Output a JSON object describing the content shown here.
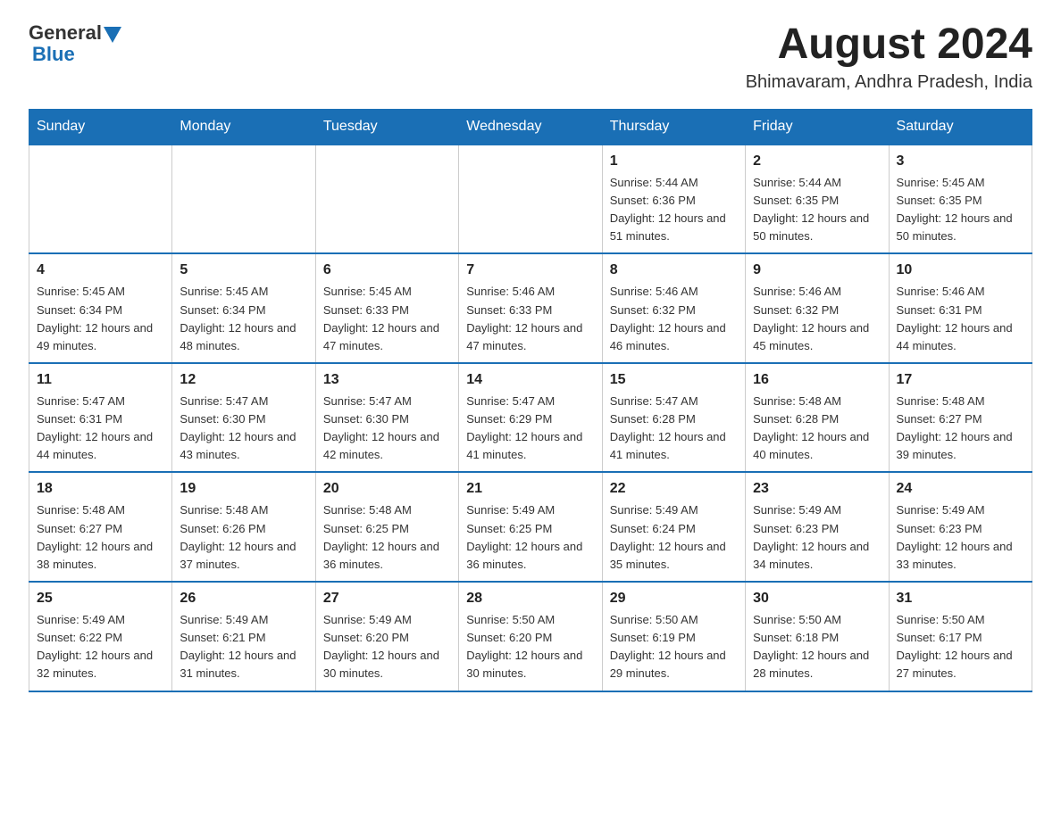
{
  "header": {
    "logo": {
      "text_general": "General",
      "text_blue": "Blue"
    },
    "title": "August 2024",
    "location": "Bhimavaram, Andhra Pradesh, India"
  },
  "days_of_week": [
    "Sunday",
    "Monday",
    "Tuesday",
    "Wednesday",
    "Thursday",
    "Friday",
    "Saturday"
  ],
  "weeks": [
    [
      {
        "day": "",
        "sunrise": "",
        "sunset": "",
        "daylight": ""
      },
      {
        "day": "",
        "sunrise": "",
        "sunset": "",
        "daylight": ""
      },
      {
        "day": "",
        "sunrise": "",
        "sunset": "",
        "daylight": ""
      },
      {
        "day": "",
        "sunrise": "",
        "sunset": "",
        "daylight": ""
      },
      {
        "day": "1",
        "sunrise": "Sunrise: 5:44 AM",
        "sunset": "Sunset: 6:36 PM",
        "daylight": "Daylight: 12 hours and 51 minutes."
      },
      {
        "day": "2",
        "sunrise": "Sunrise: 5:44 AM",
        "sunset": "Sunset: 6:35 PM",
        "daylight": "Daylight: 12 hours and 50 minutes."
      },
      {
        "day": "3",
        "sunrise": "Sunrise: 5:45 AM",
        "sunset": "Sunset: 6:35 PM",
        "daylight": "Daylight: 12 hours and 50 minutes."
      }
    ],
    [
      {
        "day": "4",
        "sunrise": "Sunrise: 5:45 AM",
        "sunset": "Sunset: 6:34 PM",
        "daylight": "Daylight: 12 hours and 49 minutes."
      },
      {
        "day": "5",
        "sunrise": "Sunrise: 5:45 AM",
        "sunset": "Sunset: 6:34 PM",
        "daylight": "Daylight: 12 hours and 48 minutes."
      },
      {
        "day": "6",
        "sunrise": "Sunrise: 5:45 AM",
        "sunset": "Sunset: 6:33 PM",
        "daylight": "Daylight: 12 hours and 47 minutes."
      },
      {
        "day": "7",
        "sunrise": "Sunrise: 5:46 AM",
        "sunset": "Sunset: 6:33 PM",
        "daylight": "Daylight: 12 hours and 47 minutes."
      },
      {
        "day": "8",
        "sunrise": "Sunrise: 5:46 AM",
        "sunset": "Sunset: 6:32 PM",
        "daylight": "Daylight: 12 hours and 46 minutes."
      },
      {
        "day": "9",
        "sunrise": "Sunrise: 5:46 AM",
        "sunset": "Sunset: 6:32 PM",
        "daylight": "Daylight: 12 hours and 45 minutes."
      },
      {
        "day": "10",
        "sunrise": "Sunrise: 5:46 AM",
        "sunset": "Sunset: 6:31 PM",
        "daylight": "Daylight: 12 hours and 44 minutes."
      }
    ],
    [
      {
        "day": "11",
        "sunrise": "Sunrise: 5:47 AM",
        "sunset": "Sunset: 6:31 PM",
        "daylight": "Daylight: 12 hours and 44 minutes."
      },
      {
        "day": "12",
        "sunrise": "Sunrise: 5:47 AM",
        "sunset": "Sunset: 6:30 PM",
        "daylight": "Daylight: 12 hours and 43 minutes."
      },
      {
        "day": "13",
        "sunrise": "Sunrise: 5:47 AM",
        "sunset": "Sunset: 6:30 PM",
        "daylight": "Daylight: 12 hours and 42 minutes."
      },
      {
        "day": "14",
        "sunrise": "Sunrise: 5:47 AM",
        "sunset": "Sunset: 6:29 PM",
        "daylight": "Daylight: 12 hours and 41 minutes."
      },
      {
        "day": "15",
        "sunrise": "Sunrise: 5:47 AM",
        "sunset": "Sunset: 6:28 PM",
        "daylight": "Daylight: 12 hours and 41 minutes."
      },
      {
        "day": "16",
        "sunrise": "Sunrise: 5:48 AM",
        "sunset": "Sunset: 6:28 PM",
        "daylight": "Daylight: 12 hours and 40 minutes."
      },
      {
        "day": "17",
        "sunrise": "Sunrise: 5:48 AM",
        "sunset": "Sunset: 6:27 PM",
        "daylight": "Daylight: 12 hours and 39 minutes."
      }
    ],
    [
      {
        "day": "18",
        "sunrise": "Sunrise: 5:48 AM",
        "sunset": "Sunset: 6:27 PM",
        "daylight": "Daylight: 12 hours and 38 minutes."
      },
      {
        "day": "19",
        "sunrise": "Sunrise: 5:48 AM",
        "sunset": "Sunset: 6:26 PM",
        "daylight": "Daylight: 12 hours and 37 minutes."
      },
      {
        "day": "20",
        "sunrise": "Sunrise: 5:48 AM",
        "sunset": "Sunset: 6:25 PM",
        "daylight": "Daylight: 12 hours and 36 minutes."
      },
      {
        "day": "21",
        "sunrise": "Sunrise: 5:49 AM",
        "sunset": "Sunset: 6:25 PM",
        "daylight": "Daylight: 12 hours and 36 minutes."
      },
      {
        "day": "22",
        "sunrise": "Sunrise: 5:49 AM",
        "sunset": "Sunset: 6:24 PM",
        "daylight": "Daylight: 12 hours and 35 minutes."
      },
      {
        "day": "23",
        "sunrise": "Sunrise: 5:49 AM",
        "sunset": "Sunset: 6:23 PM",
        "daylight": "Daylight: 12 hours and 34 minutes."
      },
      {
        "day": "24",
        "sunrise": "Sunrise: 5:49 AM",
        "sunset": "Sunset: 6:23 PM",
        "daylight": "Daylight: 12 hours and 33 minutes."
      }
    ],
    [
      {
        "day": "25",
        "sunrise": "Sunrise: 5:49 AM",
        "sunset": "Sunset: 6:22 PM",
        "daylight": "Daylight: 12 hours and 32 minutes."
      },
      {
        "day": "26",
        "sunrise": "Sunrise: 5:49 AM",
        "sunset": "Sunset: 6:21 PM",
        "daylight": "Daylight: 12 hours and 31 minutes."
      },
      {
        "day": "27",
        "sunrise": "Sunrise: 5:49 AM",
        "sunset": "Sunset: 6:20 PM",
        "daylight": "Daylight: 12 hours and 30 minutes."
      },
      {
        "day": "28",
        "sunrise": "Sunrise: 5:50 AM",
        "sunset": "Sunset: 6:20 PM",
        "daylight": "Daylight: 12 hours and 30 minutes."
      },
      {
        "day": "29",
        "sunrise": "Sunrise: 5:50 AM",
        "sunset": "Sunset: 6:19 PM",
        "daylight": "Daylight: 12 hours and 29 minutes."
      },
      {
        "day": "30",
        "sunrise": "Sunrise: 5:50 AM",
        "sunset": "Sunset: 6:18 PM",
        "daylight": "Daylight: 12 hours and 28 minutes."
      },
      {
        "day": "31",
        "sunrise": "Sunrise: 5:50 AM",
        "sunset": "Sunset: 6:17 PM",
        "daylight": "Daylight: 12 hours and 27 minutes."
      }
    ]
  ]
}
